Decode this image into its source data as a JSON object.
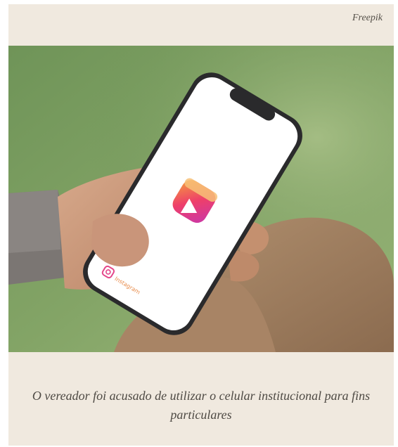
{
  "figure": {
    "credit": "Freepik",
    "caption": "O vereador foi acusado de utilizar o celular institucional para fins particulares",
    "photo_alt": "Mão segurando celular com logotipo do Instagram Reels na tela"
  },
  "phone_screen": {
    "app_icon": "instagram-reels-icon",
    "brand_badge_icon": "instagram-icon",
    "brand_badge_text": "Instagram"
  },
  "colors": {
    "background": "#f0e9df",
    "grass": "#7a9a62",
    "icon_gradient_start": "#f5a23a",
    "icon_gradient_end": "#c837ab"
  }
}
